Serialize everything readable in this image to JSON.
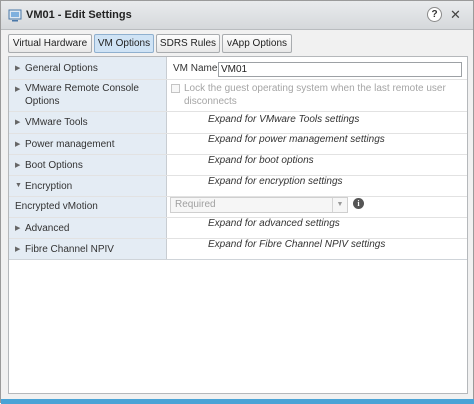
{
  "window": {
    "title": "VM01 - Edit Settings",
    "help_glyph": "?",
    "close_glyph": "✕"
  },
  "tabs": [
    {
      "label": "Virtual Hardware",
      "active": false
    },
    {
      "label": "VM Options",
      "active": true
    },
    {
      "label": "SDRS Rules",
      "active": false
    },
    {
      "label": "vApp Options",
      "active": false
    }
  ],
  "options": {
    "general": {
      "label": "General Options",
      "vm_name_label": "VM Name:",
      "vm_name_value": "VM01"
    },
    "remote_console": {
      "label_line1": "VMware Remote Console",
      "label_line2": "Options",
      "lock_line1": "Lock the guest operating system when the last remote user",
      "lock_line2": "disconnects"
    },
    "tools": {
      "label": "VMware Tools",
      "hint": "Expand for VMware Tools settings"
    },
    "power": {
      "label": "Power management",
      "hint": "Expand for power management settings"
    },
    "boot": {
      "label": "Boot Options",
      "hint": "Expand for boot options"
    },
    "encryption": {
      "label": "Encryption",
      "hint": "Expand for encryption settings"
    },
    "vmotion": {
      "label": "Encrypted vMotion",
      "value": "Required"
    },
    "advanced": {
      "label": "Advanced",
      "hint": "Expand for advanced settings"
    },
    "npiv": {
      "label": "Fibre Channel NPIV",
      "hint": "Expand for Fibre Channel NPIV settings"
    }
  },
  "icons": {
    "collapsed": "▶",
    "expanded": "▼",
    "caret": "▼",
    "info": "i"
  },
  "colors": {
    "label_column": "#e4ecf4",
    "active_tab": "#cfe3f5",
    "accent_bar": "#4aa3d6"
  }
}
